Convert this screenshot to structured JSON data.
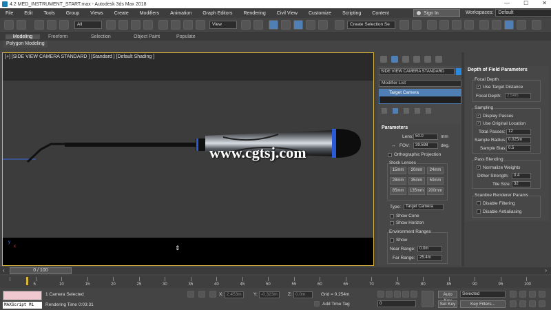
{
  "window": {
    "title": "4.2 MED_INSTRUMENT_START.max - Autodesk 3ds Max 2018",
    "min": "—",
    "max": "☐",
    "close": "✕"
  },
  "menu": [
    "File",
    "Edit",
    "Tools",
    "Group",
    "Views",
    "Create",
    "Modifiers",
    "Animation",
    "Graph Editors",
    "Rendering",
    "Civil View",
    "Customize",
    "Scripting",
    "Content"
  ],
  "account": {
    "signin": "Sign In",
    "workspace_label": "Workspaces:",
    "workspace_value": "Default"
  },
  "toolbar": {
    "filter": "All",
    "ref_coord": "View",
    "selection_set": "Create Selection Se"
  },
  "ribbon": {
    "tabs": [
      "Modeling",
      "Freeform",
      "Selection",
      "Object Paint",
      "Populate"
    ],
    "active": "Modeling",
    "sub": "Polygon Modeling"
  },
  "viewport": {
    "label": "[+] [SIDE VIEW CAMERA STANDARD ] [Standard ] [Default Shading ]",
    "watermark": "www.cgtsj.com",
    "axis_y": "y",
    "axis_x": "x"
  },
  "command": {
    "object_name": "SIDE VIEW CAMERA STANDARD",
    "object_color": "#2a8adf",
    "modifier_list": "Modifier List",
    "stack_item": "Target Camera",
    "params_title": "Parameters",
    "lens_label": "Lens:",
    "lens_value": "50.0",
    "lens_unit": "mm",
    "fov_label": "FOV:",
    "fov_value": "39.598",
    "fov_unit": "deg.",
    "ortho": "Orthographic Projection",
    "stock_title": "Stock Lenses",
    "stock": [
      "15mm",
      "20mm",
      "24mm",
      "28mm",
      "35mm",
      "50mm",
      "85mm",
      "135mm",
      "200mm"
    ],
    "type_label": "Type:",
    "type_value": "Target Camera",
    "show_cone": "Show Cone",
    "show_horizon": "Show Horizon",
    "env_title": "Environment Ranges",
    "env_show": "Show",
    "near_label": "Near Range:",
    "near_value": "0.0m",
    "far_label": "Far Range:",
    "far_value": "25.4m"
  },
  "dof": {
    "title": "Depth of Field Parameters",
    "focal_title": "Focal Depth",
    "use_target": "Use Target Distance",
    "focal_label": "Focal Depth:",
    "focal_value": "2.54m",
    "sampling_title": "Sampling",
    "display_passes": "Display Passes",
    "use_original": "Use Original Location",
    "total_label": "Total Passes:",
    "total_value": "12",
    "radius_label": "Sample Radius:",
    "radius_value": "0.025m",
    "bias_label": "Sample Bias:",
    "bias_value": "0.5",
    "blend_title": "Pass Blending",
    "normalize": "Normalize Weights",
    "dither_label": "Dither Strength:",
    "dither_value": "0.4",
    "tile_label": "Tile Size:",
    "tile_value": "32",
    "scanline_title": "Scanline Renderer Params",
    "disable_filter": "Disable Filtering",
    "disable_aa": "Disable Antialiasing"
  },
  "timeline": {
    "slider": "0 / 100",
    "ticks": [
      "0",
      "5",
      "10",
      "15",
      "20",
      "25",
      "30",
      "35",
      "40",
      "45",
      "50",
      "55",
      "60",
      "65",
      "70",
      "75",
      "80",
      "85",
      "90",
      "95",
      "100"
    ]
  },
  "status": {
    "maxscript": "MAXScript Mi",
    "selection": "1 Camera Selected",
    "render_time_label": "Rendering Time",
    "render_time": "0:03:31",
    "x_label": "X:",
    "x_value": "2.453m",
    "y_label": "Y:",
    "y_value": "-0.323m",
    "z_label": "Z:",
    "z_value": "0.0m",
    "grid": "Grid = 0.254m",
    "add_time_tag": "Add Time Tag",
    "frame": "0",
    "auto_key": "Auto Key",
    "set_key": "Set Key",
    "selected": "Selected",
    "key_filters": "Key Filters..."
  }
}
